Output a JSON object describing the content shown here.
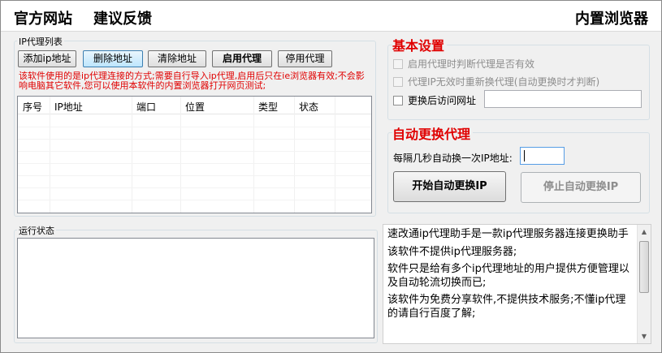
{
  "topbar": {
    "official_site": "官方网站",
    "feedback": "建议反馈",
    "builtin_browser": "内置浏览器"
  },
  "proxy_list": {
    "group_title": "IP代理列表",
    "buttons": {
      "add": "添加ip地址",
      "delete": "删除地址",
      "clear": "清除地址",
      "enable": "启用代理",
      "disable": "停用代理"
    },
    "warning": "该软件使用的是ip代理连接的方式;需要自行导入ip代理,启用后只在ie浏览器有效;不会影响电脑其它软件,您可以使用本软件的内置浏览器打开网页测试;",
    "columns": [
      "序号",
      "IP地址",
      "端口",
      "位置",
      "类型",
      "状态"
    ],
    "rows": []
  },
  "basic_settings": {
    "title": "基本设置",
    "options": [
      {
        "label": "启用代理时判断代理是否有效",
        "checked": false,
        "enabled": false
      },
      {
        "label": "代理IP无效时重新换代理(自动更换时才判断)",
        "checked": false,
        "enabled": false
      },
      {
        "label": "更换后访问网址",
        "checked": false,
        "enabled": true
      }
    ],
    "url_value": ""
  },
  "auto_switch": {
    "title": "自动更换代理",
    "interval_label": "每隔几秒自动换一次IP地址:",
    "interval_value": "",
    "start_label": "开始自动更换IP",
    "stop_label": "停止自动更换IP"
  },
  "run_status": {
    "title": "运行状态",
    "log": ""
  },
  "info": {
    "paragraphs": [
      "速改通ip代理助手是一款ip代理服务器连接更换助手",
      "该软件不提供ip代理服务器;",
      "软件只是给有多个ip代理地址的用户提供方便管理以及自动轮流切换而已;",
      "该软件为免费分享软件,不提供技术服务;不懂ip代理的请自行百度了解;"
    ]
  },
  "colors": {
    "accent_red": "#e00000",
    "disabled_text": "#8d8d8d",
    "selected_button": "#bee6fd"
  }
}
